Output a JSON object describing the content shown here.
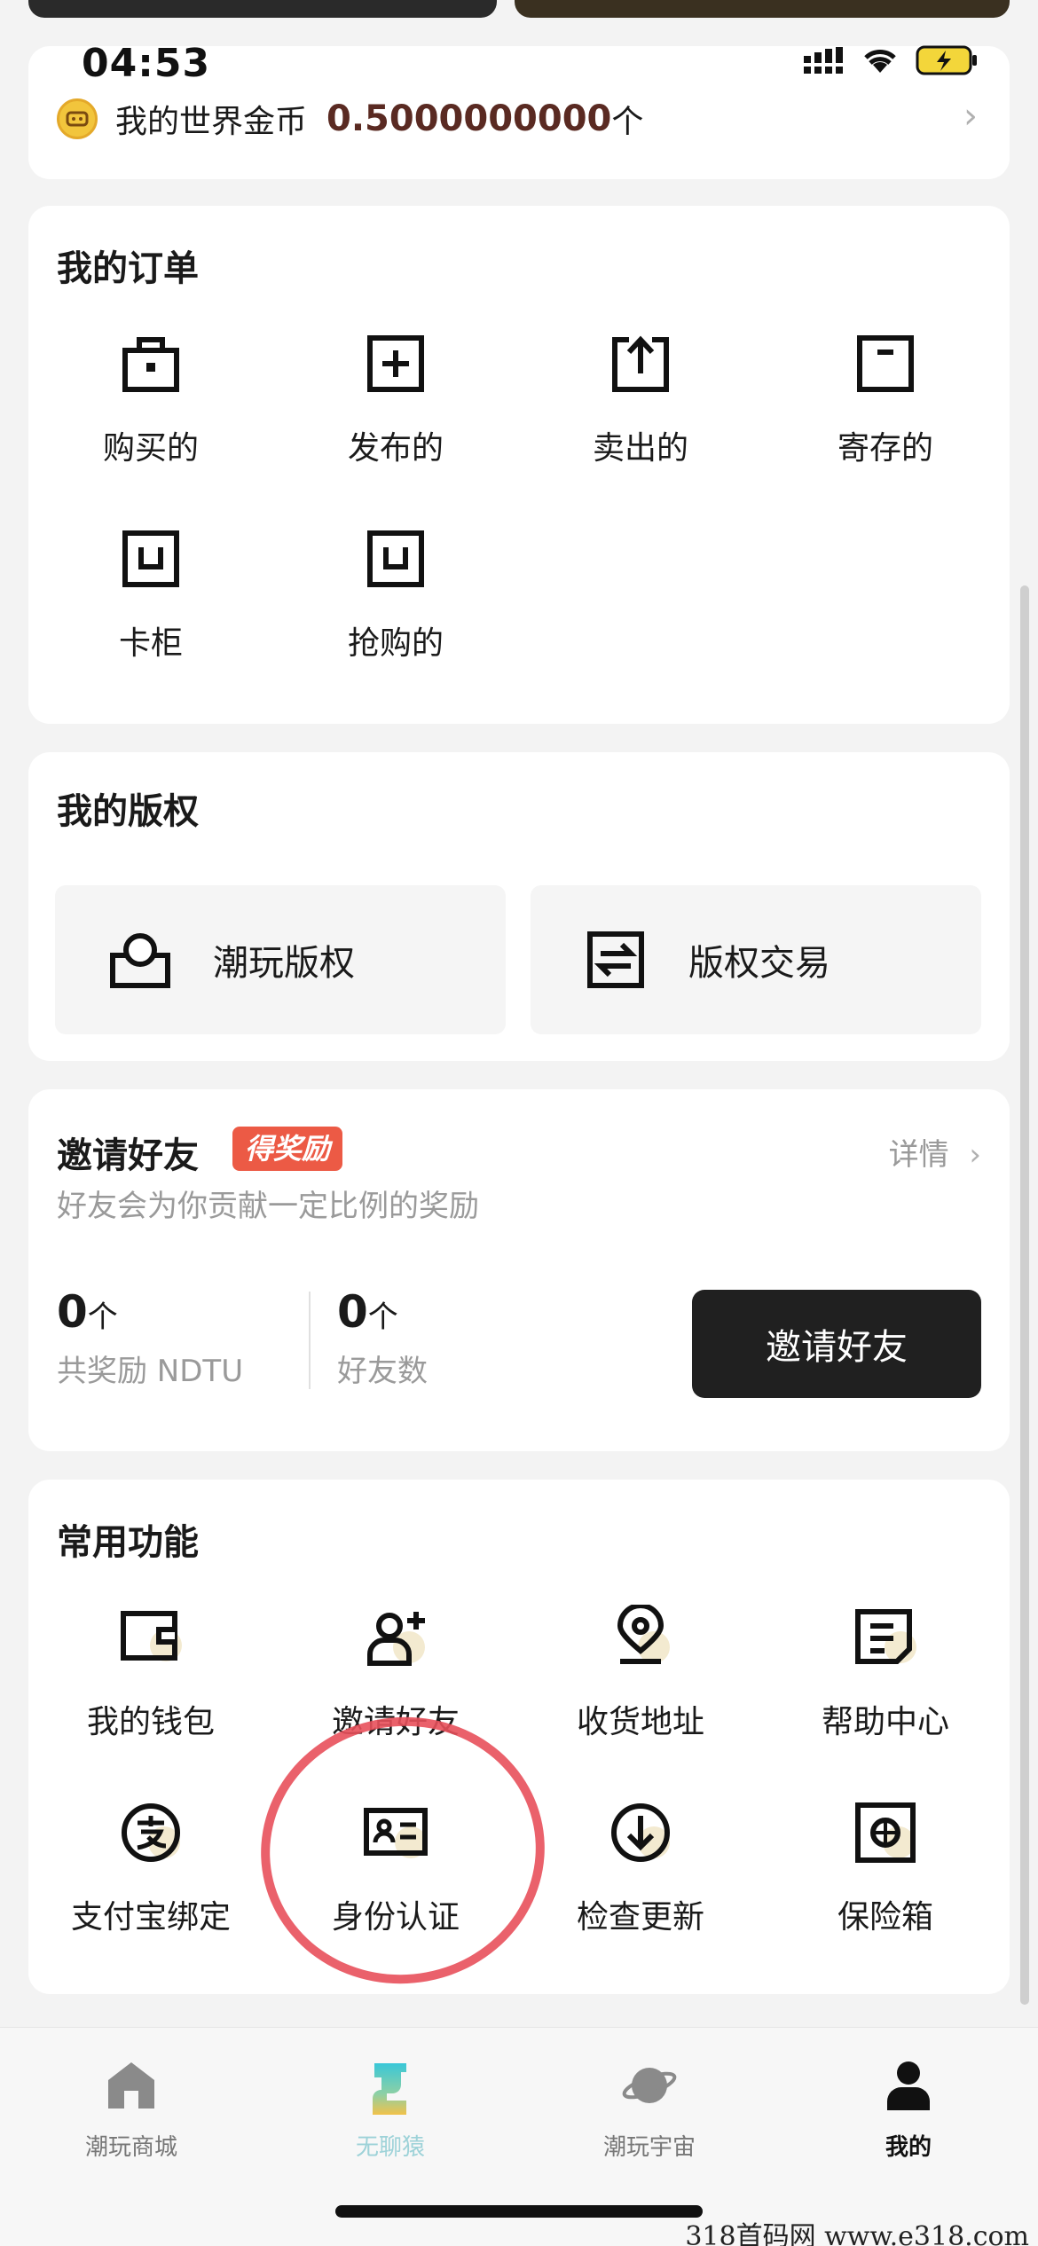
{
  "status_bar": {
    "time": "04:53"
  },
  "coin": {
    "label": "我的世界金币",
    "amount": "0.5000000000",
    "unit": "个"
  },
  "orders": {
    "title": "我的订单",
    "items": [
      {
        "label": "购买的",
        "icon": "shopping-bag-icon"
      },
      {
        "label": "发布的",
        "icon": "publish-plus-icon"
      },
      {
        "label": "卖出的",
        "icon": "upload-icon"
      },
      {
        "label": "寄存的",
        "icon": "storage-box-icon"
      },
      {
        "label": "卡柜",
        "icon": "locker-icon"
      },
      {
        "label": "抢购的",
        "icon": "flash-buy-icon"
      }
    ]
  },
  "copyright": {
    "title": "我的版权",
    "tiles": [
      {
        "label": "潮玩版权",
        "icon": "copyright-bag-icon"
      },
      {
        "label": "版权交易",
        "icon": "exchange-icon"
      }
    ]
  },
  "invite": {
    "title": "邀请好友",
    "badge": "得奖励",
    "details": "详情",
    "subtitle": "好友会为你贡献一定比例的奖励",
    "stats": [
      {
        "value": "0",
        "unit": "个",
        "caption": "共奖励 NDTU"
      },
      {
        "value": "0",
        "unit": "个",
        "caption": "好友数"
      }
    ],
    "button": "邀请好友"
  },
  "common": {
    "title": "常用功能",
    "items": [
      {
        "label": "我的钱包",
        "icon": "wallet-icon"
      },
      {
        "label": "邀请好友",
        "icon": "add-friend-icon"
      },
      {
        "label": "收货地址",
        "icon": "location-pin-icon"
      },
      {
        "label": "帮助中心",
        "icon": "help-doc-icon"
      },
      {
        "label": "支付宝绑定",
        "icon": "alipay-icon"
      },
      {
        "label": "身份认证",
        "icon": "id-card-icon"
      },
      {
        "label": "检查更新",
        "icon": "download-icon"
      },
      {
        "label": "保险箱",
        "icon": "safe-icon"
      }
    ]
  },
  "tabbar": {
    "tabs": [
      {
        "label": "潮玩商城",
        "icon": "home-icon"
      },
      {
        "label": "无聊猿",
        "icon": "ape-icon"
      },
      {
        "label": "潮玩宇宙",
        "icon": "planet-icon"
      },
      {
        "label": "我的",
        "icon": "person-icon"
      }
    ]
  },
  "watermark": "318首码网 www.e318.com"
}
